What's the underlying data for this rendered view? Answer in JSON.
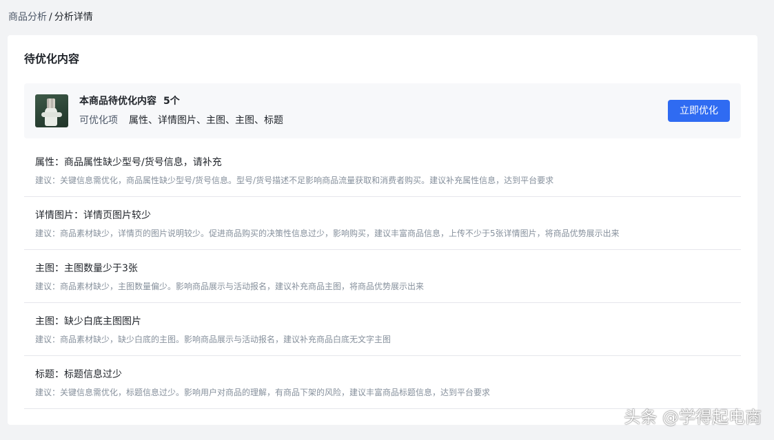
{
  "breadcrumb": {
    "parent": "商品分析",
    "separator": "/",
    "current": "分析详情"
  },
  "card": {
    "title": "待优化内容"
  },
  "summary": {
    "title": "本商品待优化内容",
    "count": "5个",
    "items_label": "可优化项",
    "items_value": "属性、详情图片、主图、主图、标题",
    "button_label": "立即优化"
  },
  "issues": [
    {
      "title": "属性：商品属性缺少型号/货号信息，请补充",
      "desc": "建议：关键信息需优化，商品属性缺少型号/货号信息。型号/货号描述不足影响商品流量获取和消费者购买。建议补充属性信息，达到平台要求"
    },
    {
      "title": "详情图片：详情页图片较少",
      "desc": "建议：商品素材缺少，详情页的图片说明较少。促进商品购买的决策性信息过少，影响购买，建议丰富商品信息，上传不少于5张详情图片，将商品优势展示出来"
    },
    {
      "title": "主图：主图数量少于3张",
      "desc": "建议：商品素材缺少，主图数量偏少。影响商品展示与活动报名，建议补充商品主图，将商品优势展示出来"
    },
    {
      "title": "主图：缺少白底主图图片",
      "desc": "建议：商品素材缺少，缺少白底的主图。影响商品展示与活动报名，建议补充商品白底无文字主图"
    },
    {
      "title": "标题：标题信息过少",
      "desc": "建议：关键信息需优化，标题信息过少。影响用户对商品的理解，有商品下架的风险，建议丰富商品标题信息，达到平台要求"
    }
  ],
  "watermark": "头条 @学得起电商",
  "colors": {
    "primary": "#2f6bf2",
    "background": "#f2f3f5",
    "summary_bg": "#f7f8fa"
  }
}
